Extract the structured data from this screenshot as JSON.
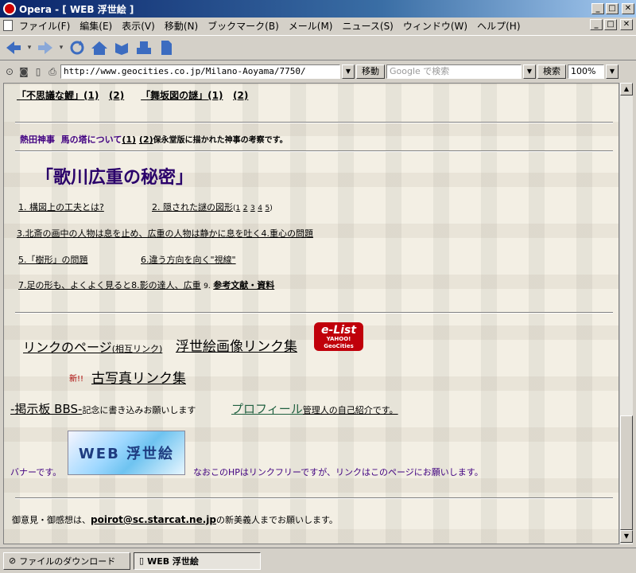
{
  "window": {
    "title": "Opera - [ WEB 浮世絵 ]",
    "min": "_",
    "max": "□",
    "close": "✕"
  },
  "menu": {
    "items": [
      "ファイル(F)",
      "編集(E)",
      "表示(V)",
      "移動(N)",
      "ブックマーク(B)",
      "メール(M)",
      "ニュース(S)",
      "ウィンドウ(W)",
      "ヘルプ(H)"
    ]
  },
  "address": {
    "url": "http://www.geocities.co.jp/Milano-Aoyama/7750/",
    "go_label": "移動",
    "search_placeholder": "Google で検索",
    "search_label": "検索",
    "zoom": "100%"
  },
  "page": {
    "nav1": {
      "a_title": "「不思議な鯉」",
      "a_1": "(1)",
      "a_2": "(2)",
      "b_title": "「舞坂図の謎」",
      "b_1": "(1)",
      "b_2": "(2)"
    },
    "atsuta": {
      "label": "熱田神事",
      "link_text": "馬の塔について",
      "l1": "(1)",
      "l2": "(2)",
      "desc": "保永堂版に描かれた神事の考察です。"
    },
    "hiroshige_title": "「歌川広重の秘密」",
    "toc": {
      "i1": "1. 構図上の工夫とは?",
      "i2": "2. 隠された謎の図形",
      "i2_p1": "1",
      "i2_p2": "2",
      "i2_p3": "3",
      "i2_p4": "4",
      "i2_p5": "5",
      "i3": "3.北斎の画中の人物は息を止め、広重の人物は静かに息を吐く",
      "i4": "4.重心の問題",
      "i5": "5.「樹形」の問題",
      "i6": "6.違う方向を向く\"視線\"",
      "i7": "7.足の形も、よくよく見ると",
      "i8": "8.影の達人、広重",
      "i9": "9.",
      "i9_link": "参考文献・資料"
    },
    "links": {
      "link_page": "リンクのページ",
      "link_page_small": "(相互リンク)",
      "ukiyoe_link": "浮世絵画像リンク集",
      "new_label": "新!!",
      "old_photo": "古写真リンク集",
      "bbs": "-掲示板 BBS-",
      "bbs_desc": "記念に書き込みお願いします",
      "profile": "プロフィール",
      "profile_desc": "管理人の自己紹介です。",
      "elist_text": "e-List",
      "elist_sub": "YAHOO! GeoCities"
    },
    "banner": {
      "prefix": "バナーです。",
      "text": "WEB 浮世絵",
      "note": "なおこのHPはリンクフリーですが、リンクはこのページにお願いします。"
    },
    "contact": {
      "prefix": "御意見・御感想は、",
      "email": "poirot@sc.starcat.ne.jp",
      "suffix": "の新美義人までお願いします。"
    }
  },
  "statusbar": {
    "downloads": "ファイルのダウンロード",
    "active_tab": "WEB 浮世絵"
  }
}
